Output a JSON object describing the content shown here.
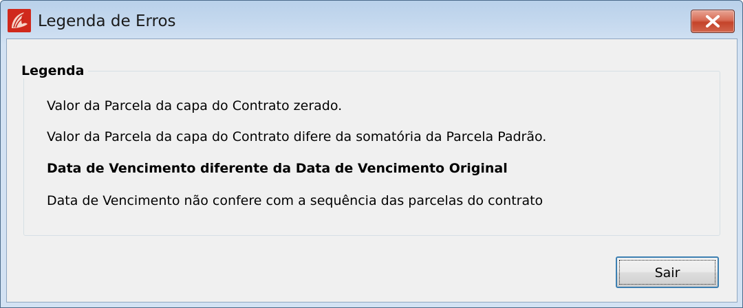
{
  "window": {
    "title": "Legenda de Erros",
    "icon": "red-shell-app-icon"
  },
  "titlebar": {
    "close_icon": "close-icon"
  },
  "legend": {
    "title": "Legenda",
    "items": [
      {
        "text": "Valor da Parcela da capa do Contrato zerado.",
        "bold": false
      },
      {
        "text": "Valor da Parcela da capa do Contrato difere da somatória da Parcela Padrão.",
        "bold": false
      },
      {
        "text": "Data de Vencimento diferente da Data de Vencimento Original",
        "bold": true
      },
      {
        "text": "Data de Vencimento não confere com a sequência das parcelas do contrato",
        "bold": false
      }
    ]
  },
  "actions": {
    "sair_label": "Sair"
  },
  "colors": {
    "close_button": "#c4432a",
    "focus_border": "#3c7fb1",
    "app_icon": "#cc2a1e"
  }
}
